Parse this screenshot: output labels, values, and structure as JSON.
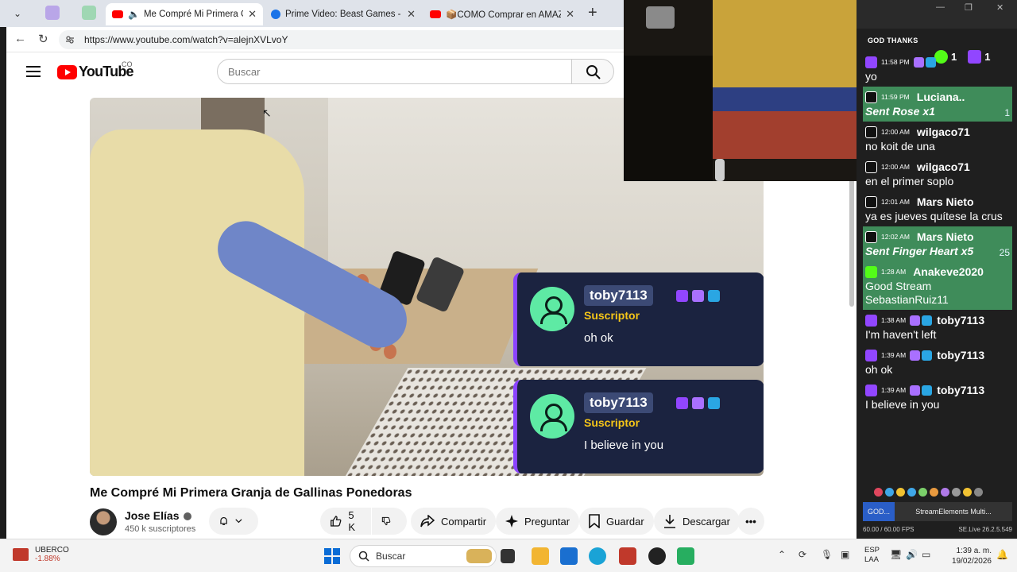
{
  "browser": {
    "tabs": [
      {
        "title": "Me Compré Mi Primera Granja",
        "active": true
      },
      {
        "title": "Prime Video: Beast Games - Temp",
        "active": false
      },
      {
        "title": "📦COMO Comprar en AMAZON",
        "active": false
      }
    ],
    "url": "https://www.youtube.com/watch?v=alejnXVLvoY"
  },
  "youtube": {
    "logo_text": "YouTube",
    "country_code": "CO",
    "search_placeholder": "Buscar",
    "video_title": "Me Compré Mi Primera Granja de Gallinas Ponedoras",
    "channel_name": "Jose Elías",
    "subscribers": "450 k suscriptores",
    "likes": "5 K",
    "actions": {
      "share": "Compartir",
      "ask": "Preguntar",
      "save": "Guardar",
      "download": "Descargar"
    }
  },
  "overlay_cards": [
    {
      "username": "toby7113",
      "role": "Suscriptor",
      "message": "oh ok"
    },
    {
      "username": "toby7113",
      "role": "Suscriptor",
      "message": "I believe in you"
    }
  ],
  "chat_panel": {
    "header": "GOD THANKS",
    "counter_a": "1",
    "counter_b": "1",
    "messages": [
      {
        "platform": "twitch",
        "time": "11:58 PM",
        "user": "",
        "text": "yo",
        "gift": false,
        "highlight": false
      },
      {
        "platform": "tiktok",
        "time": "11:59 PM",
        "user": "Luciana..",
        "text": "Sent Rose x1",
        "gift": true,
        "amount": "1",
        "highlight": true
      },
      {
        "platform": "tiktok",
        "time": "12:00 AM",
        "user": "wilgaco71",
        "text": "no koit de una",
        "gift": false,
        "highlight": false
      },
      {
        "platform": "tiktok",
        "time": "12:00 AM",
        "user": "wilgaco71",
        "text": "en el primer soplo",
        "gift": false,
        "highlight": false
      },
      {
        "platform": "tiktok",
        "time": "12:01 AM",
        "user": "Mars Nieto",
        "text": "ya es jueves quítese la crus",
        "gift": false,
        "highlight": false
      },
      {
        "platform": "tiktok",
        "time": "12:02 AM",
        "user": "Mars Nieto",
        "text": "Sent Finger Heart x5",
        "gift": true,
        "amount": "25",
        "highlight": true
      },
      {
        "platform": "kick",
        "time": "1:28 AM",
        "user": "Anakeve2020",
        "text": "Good Stream SebastianRuiz11",
        "gift": false,
        "highlight": true
      },
      {
        "platform": "twitch",
        "time": "1:38 AM",
        "user": "toby7113",
        "text": "I'm haven't left",
        "gift": false,
        "highlight": false
      },
      {
        "platform": "twitch",
        "time": "1:39 AM",
        "user": "toby7113",
        "text": "oh ok",
        "gift": false,
        "highlight": false
      },
      {
        "platform": "twitch",
        "time": "1:39 AM",
        "user": "toby7113",
        "text": "I believe in you",
        "gift": false,
        "highlight": false
      }
    ],
    "tabs": [
      "GOD...",
      "StreamElements Multi..."
    ],
    "fps": "60.00 / 60.00 FPS",
    "version": "SE.Live 26.2.5.549"
  },
  "taskbar": {
    "stock_name": "UBERCO",
    "stock_change": "-1.88%",
    "search_placeholder": "Buscar",
    "lang": "ESP",
    "layout": "LAA",
    "time": "1:39 a. m.",
    "date": "19/02/2026"
  },
  "colors": {
    "youtube_red": "#ff0000",
    "twitch_purple": "#9146ff",
    "kick_green": "#53fc18",
    "chat_highlight": "#3f8c5a",
    "card_bg": "#1b2340",
    "subscriber_gold": "#f5c518"
  }
}
